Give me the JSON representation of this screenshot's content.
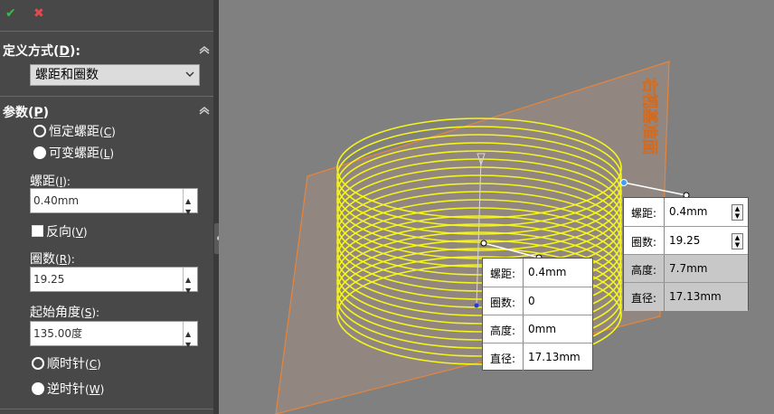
{
  "toolbar": {
    "ok_icon": "✔",
    "cancel_icon": "✖"
  },
  "define_by": {
    "title": "定义方式",
    "hotkey": "D",
    "selected": "螺距和圈数"
  },
  "params": {
    "title": "参数",
    "hotkey": "P",
    "pitch_type_options": [
      {
        "label": "恒定螺距",
        "hotkey": "C",
        "selected": true
      },
      {
        "label": "可变螺距",
        "hotkey": "L",
        "selected": false
      }
    ],
    "pitch": {
      "label": "螺距",
      "hotkey": "I",
      "value": "0.40mm"
    },
    "reverse": {
      "label": "反向",
      "hotkey": "V",
      "checked": false
    },
    "revolutions": {
      "label": "圈数",
      "hotkey": "R",
      "value": "19.25"
    },
    "start_angle": {
      "label": "起始角度",
      "hotkey": "S",
      "value": "135.00度"
    },
    "direction_options": [
      {
        "label": "顺时针",
        "hotkey": "C",
        "selected": false
      },
      {
        "label": "逆时针",
        "hotkey": "W",
        "selected": true
      }
    ]
  },
  "viewport": {
    "plane_label": "右视基准面",
    "helix_color": "#f5f51e",
    "plane_color": "#e8843a",
    "callout_start": {
      "rows": [
        {
          "label": "螺距:",
          "value": "0.4mm"
        },
        {
          "label": "圈数:",
          "value": "0"
        },
        {
          "label": "高度:",
          "value": "0mm"
        },
        {
          "label": "直径:",
          "value": "17.13mm"
        }
      ]
    },
    "callout_end": {
      "rows": [
        {
          "label": "螺距:",
          "value": "0.4mm"
        },
        {
          "label": "圈数:",
          "value": "19.25"
        },
        {
          "label": "高度:",
          "value": "7.7mm"
        },
        {
          "label": "直径:",
          "value": "17.13mm"
        }
      ]
    }
  }
}
